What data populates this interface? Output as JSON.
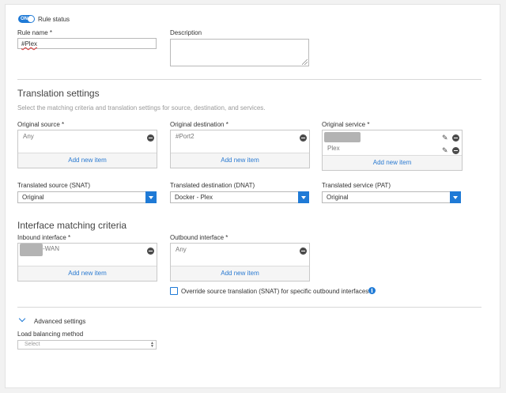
{
  "rule_status": {
    "toggle_text": "ON",
    "label": "Rule status"
  },
  "rule_name": {
    "label": "Rule name *",
    "value": "#Plex"
  },
  "description": {
    "label": "Description"
  },
  "translation": {
    "heading": "Translation settings",
    "subtitle": "Select the matching criteria and translation settings for source, destination, and services."
  },
  "original_source": {
    "label": "Original source *",
    "items": [
      "Any"
    ],
    "add_label": "Add new item"
  },
  "original_destination": {
    "label": "Original destination *",
    "items": [
      "#Port2"
    ],
    "add_label": "Add new item"
  },
  "original_service": {
    "label": "Original service *",
    "items": [
      "",
      "Plex"
    ],
    "add_label": "Add new item"
  },
  "translated_source": {
    "label": "Translated source (SNAT)",
    "value": "Original"
  },
  "translated_destination": {
    "label": "Translated destination (DNAT)",
    "value": "Docker - Plex"
  },
  "translated_service": {
    "label": "Translated service (PAT)",
    "value": "Original"
  },
  "interface": {
    "heading": "Interface matching criteria"
  },
  "inbound": {
    "label": "Inbound interface *",
    "item_suffix": "-WAN",
    "add_label": "Add new item"
  },
  "outbound": {
    "label": "Outbound interface *",
    "items": [
      "Any"
    ],
    "add_label": "Add new item"
  },
  "override": {
    "label": "Override source translation (SNAT) for specific outbound interfaces"
  },
  "advanced": {
    "label": "Advanced settings"
  },
  "load_balancing": {
    "label": "Load balancing method",
    "placeholder": "Select"
  },
  "colors": {
    "accent": "#1f7ad6",
    "link": "#2a7ad1"
  },
  "icons": [
    "minus-circle-icon",
    "pencil-icon",
    "dropdown-arrow-icon",
    "info-icon",
    "chevron-down-icon"
  ]
}
